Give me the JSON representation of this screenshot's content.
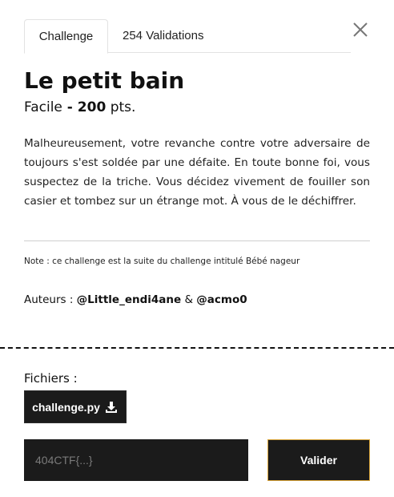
{
  "tabs": [
    {
      "label": "Challenge",
      "active": true
    },
    {
      "label": "254 Validations",
      "active": false
    }
  ],
  "challenge": {
    "title": "Le petit bain",
    "difficulty": "Facile",
    "separator": " - ",
    "points": "200",
    "points_suffix": " pts.",
    "description": "Malheureusement, votre revanche contre votre adversaire de toujours s'est soldée par une défaite. En toute bonne foi, vous suspectez de la triche. Vous décidez vivement de fouiller son casier et tombez sur un étrange mot. À vous de le déchiffrer.",
    "note": "Note : ce challenge est la suite du challenge intitulé Bébé nageur",
    "authors_label": "Auteurs : ",
    "author1_prefix": "@",
    "author1": "Little_endi4ane",
    "authors_sep": " & ",
    "author2_prefix": "@",
    "author2": "acmo0"
  },
  "files": {
    "label": "Fichiers :",
    "items": [
      {
        "name": "challenge.py",
        "icon": "download-icon"
      }
    ]
  },
  "flag_form": {
    "placeholder": "404CTF{...}",
    "value": "",
    "submit_label": "Valider"
  },
  "colors": {
    "dark": "#1b1b1b",
    "accent_border": "#d9a53a",
    "divider": "#cfcfcf"
  },
  "icons": {
    "close": "close-icon",
    "download": "download-icon"
  }
}
